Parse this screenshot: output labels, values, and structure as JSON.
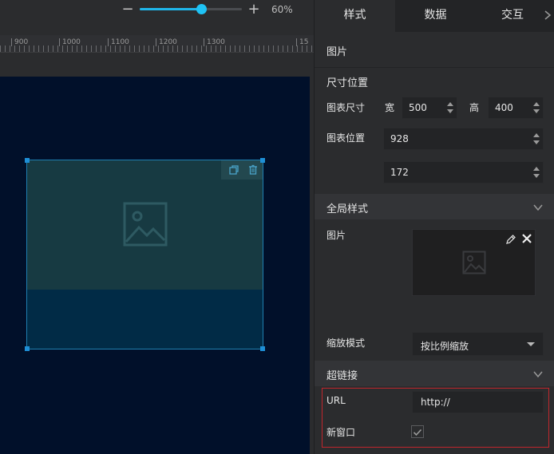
{
  "zoom": {
    "value_label": "60%",
    "level": 0.6
  },
  "ruler": {
    "labels": [
      "900",
      "1000",
      "1100",
      "1200",
      "1300",
      "15"
    ]
  },
  "tabs": [
    {
      "label": "样式",
      "active": true
    },
    {
      "label": "数据",
      "active": false
    },
    {
      "label": "交互",
      "active": false
    }
  ],
  "panel": {
    "component_title": "图片",
    "size_section": {
      "title": "尺寸位置",
      "size_label": "图表尺寸",
      "width_label": "宽",
      "width_value": "500",
      "height_label": "高",
      "height_value": "400",
      "position_label": "图表位置",
      "x_value": "928",
      "y_value": "172"
    },
    "global_section": {
      "title": "全局样式",
      "image_label": "图片",
      "scale_label": "缩放模式",
      "scale_value": "按比例缩放"
    },
    "link_section": {
      "title": "超链接",
      "url_label": "URL",
      "url_value": "http://",
      "new_window_label": "新窗口",
      "new_window_checked": true
    }
  },
  "colors": {
    "accent": "#1fb6ea",
    "canvas_bg": "#01102a",
    "highlight_border": "#c0262d"
  }
}
